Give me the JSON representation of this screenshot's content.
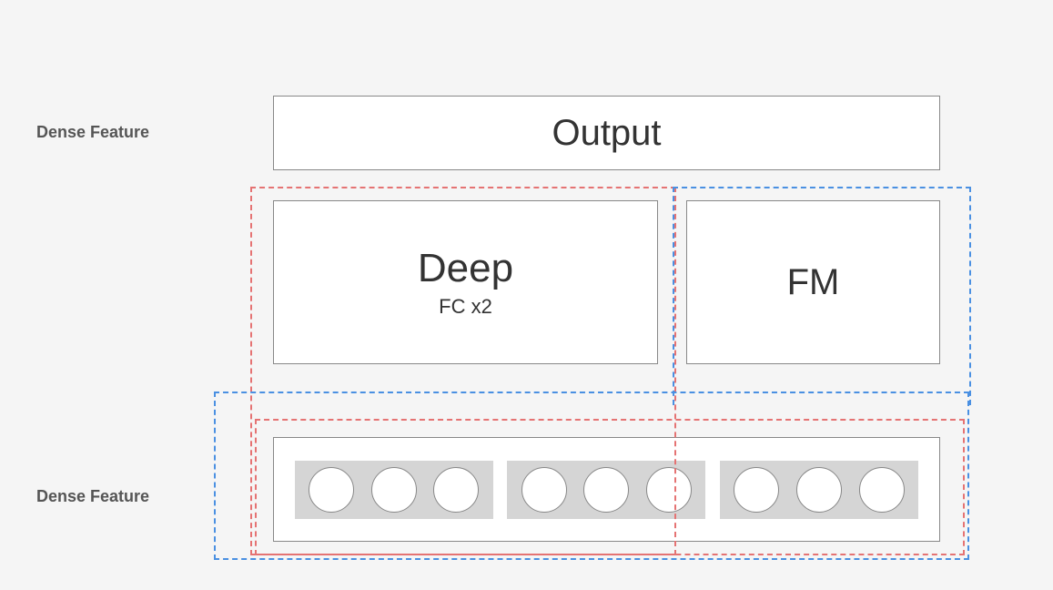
{
  "labels": {
    "top": "Dense Feature",
    "bottom": "Dense Feature"
  },
  "blocks": {
    "output": "Output",
    "deep_title": "Deep",
    "deep_sub": "FC x2",
    "fm": "FM"
  },
  "embedding": {
    "groups": 3,
    "circles_per_group": 3
  },
  "colors": {
    "red_dashed": "#e57373",
    "blue_dashed": "#4a90e2",
    "background": "#f5f5f5",
    "box_bg": "#ffffff",
    "box_border": "#888888",
    "embed_group_bg": "#d5d5d5"
  }
}
